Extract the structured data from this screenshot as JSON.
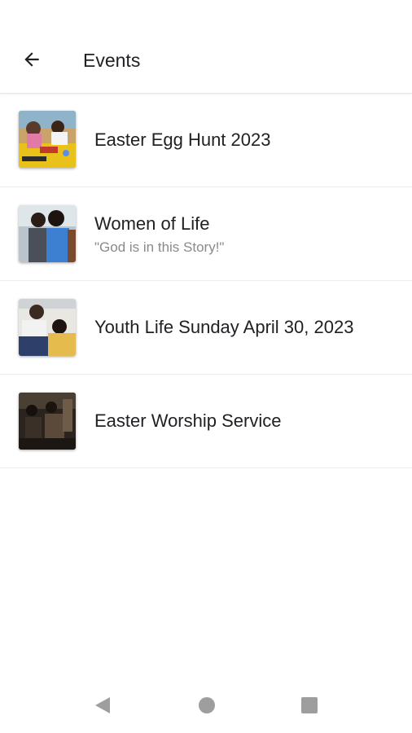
{
  "header": {
    "title": "Events",
    "back_icon": "arrow-left-icon"
  },
  "events": [
    {
      "title": "Easter Egg Hunt 2023",
      "subtitle": ""
    },
    {
      "title": "Women of Life",
      "subtitle": "\"God is in this Story!\""
    },
    {
      "title": "Youth Life Sunday April 30, 2023",
      "subtitle": ""
    },
    {
      "title": "Easter Worship Service",
      "subtitle": ""
    }
  ],
  "nav": {
    "back_icon": "triangle-back-icon",
    "home_icon": "circle-home-icon",
    "recents_icon": "square-recents-icon"
  },
  "colors": {
    "text_primary": "#202124",
    "text_secondary": "#8a8a8a",
    "divider": "#ececec",
    "nav_icon": "#9e9e9e"
  }
}
